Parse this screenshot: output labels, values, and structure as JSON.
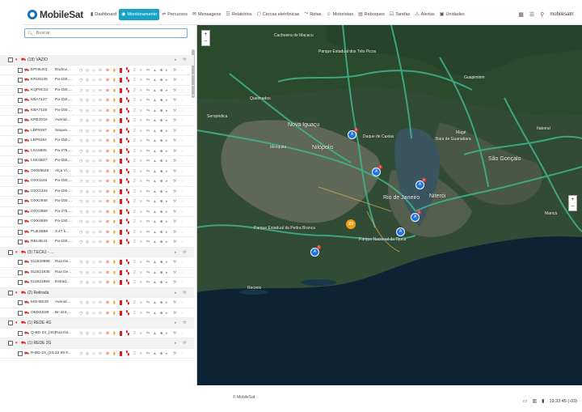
{
  "app": {
    "name": "MobileSat"
  },
  "nav": [
    {
      "label": "Dashboard",
      "icon": "chart-icon",
      "active": false
    },
    {
      "label": "Monitoramento",
      "icon": "monitor-icon",
      "active": true
    },
    {
      "label": "Percursos",
      "icon": "route-icon",
      "active": false
    },
    {
      "label": "Mensagens",
      "icon": "message-icon",
      "active": false
    },
    {
      "label": "Relatórios",
      "icon": "report-icon",
      "active": false
    },
    {
      "label": "Cercas eletrônicas",
      "icon": "fence-icon",
      "active": false
    },
    {
      "label": "Rotas",
      "icon": "road-icon",
      "active": false
    },
    {
      "label": "Motoristas",
      "icon": "driver-icon",
      "active": false
    },
    {
      "label": "Reboques",
      "icon": "trailer-icon",
      "active": false
    },
    {
      "label": "Tarefas",
      "icon": "tasks-icon",
      "active": false
    },
    {
      "label": "Alertas",
      "icon": "alert-icon",
      "active": false
    },
    {
      "label": "Unidades",
      "icon": "unit-icon",
      "active": false
    }
  ],
  "user": {
    "name": "mobilesatrr"
  },
  "search": {
    "placeholder": "Buscar",
    "value": ""
  },
  "rows": [
    {
      "type": "group",
      "name": "(18) VAZIO"
    },
    {
      "type": "vehicle",
      "plate": "EPH6J03",
      "addr": "Rodovi..."
    },
    {
      "type": "vehicle",
      "plate": "KRU8105",
      "addr": "Pa-150,..."
    },
    {
      "type": "vehicle",
      "plate": "KQP8C10",
      "addr": "Pa-150,..."
    },
    {
      "type": "vehicle",
      "plate": "KBA7127",
      "addr": "Pa-150,..."
    },
    {
      "type": "vehicle",
      "plate": "KBA7128",
      "addr": "Pa-150,..."
    },
    {
      "type": "vehicle",
      "plate": "KRE2019",
      "addr": "Avenid..."
    },
    {
      "type": "vehicle",
      "plate": "LBP8187",
      "addr": "Sequei..."
    },
    {
      "type": "vehicle",
      "plate": "LBP8184",
      "addr": "Pa-150,..."
    },
    {
      "type": "vehicle",
      "plate": "LSA5505",
      "addr": "Pa-275,..."
    },
    {
      "type": "vehicle",
      "plate": "LSE4B27",
      "addr": "Pa-150,..."
    },
    {
      "type": "vehicle",
      "plate": "OXW9628",
      "addr": "Alça Vi..."
    },
    {
      "type": "vehicle",
      "plate": "OXX1184",
      "addr": "Pa-150,..."
    },
    {
      "type": "vehicle",
      "plate": "OXX1244",
      "addr": "Pa-150,..."
    },
    {
      "type": "vehicle",
      "plate": "OXX2948",
      "addr": "Pa-150,..."
    },
    {
      "type": "vehicle",
      "plate": "OXX2968",
      "addr": "Pa-275,..."
    },
    {
      "type": "vehicle",
      "plate": "OXX4659",
      "addr": "Pa-150,..."
    },
    {
      "type": "vehicle",
      "plate": "PUE2B98",
      "addr": "3.47 k..."
    },
    {
      "type": "vehicle",
      "plate": "RBL6E43",
      "addr": "Pa-150,..."
    },
    {
      "type": "group",
      "name": "(3) TECRJ - ..."
    },
    {
      "type": "vehicle",
      "plate": "511620998",
      "addr": "Rua De..."
    },
    {
      "type": "vehicle",
      "plate": "511621835",
      "addr": "Rua De..."
    },
    {
      "type": "vehicle",
      "plate": "511621884",
      "addr": "Estrad..."
    },
    {
      "type": "group",
      "name": "(2) Retirada"
    },
    {
      "type": "vehicle",
      "plate": "MSH0E49",
      "addr": "Avenid..."
    },
    {
      "type": "vehicle",
      "plate": "OMX5D39",
      "addr": "Br-324,..."
    },
    {
      "type": "group",
      "name": "(1) REDE 4G"
    },
    {
      "type": "vehicle",
      "plate": "Q-BD-23_(4G)",
      "addr": "Rua Da..."
    },
    {
      "type": "group",
      "name": "(1) REDE 2G"
    },
    {
      "type": "vehicle",
      "plate": "R-BD-23_(2G...",
      "addr": "22 69 K..."
    }
  ],
  "map": {
    "labels": [
      {
        "t": "Cachoeira de Macacu",
        "big": false
      },
      {
        "t": "Parque Estadual dos Três Picos",
        "big": false
      },
      {
        "t": "Queimados",
        "big": false
      },
      {
        "t": "Nova Iguaçu",
        "big": true
      },
      {
        "t": "Mesquita",
        "big": false
      },
      {
        "t": "Nilópolis",
        "big": true
      },
      {
        "t": "Duque de Caxias",
        "big": false
      },
      {
        "t": "Baía de Guanabara",
        "big": false
      },
      {
        "t": "São Gonçalo",
        "big": true
      },
      {
        "t": "Niterói",
        "big": true
      },
      {
        "t": "Rio de Janeiro",
        "big": true
      },
      {
        "t": "Parque Estadual da Pedra Branca",
        "big": false
      },
      {
        "t": "Parque Nacional da Tijuca",
        "big": false
      },
      {
        "t": "Guapimirim",
        "big": false
      },
      {
        "t": "Magé",
        "big": false
      },
      {
        "t": "Itaboraí",
        "big": false
      },
      {
        "t": "Maricá",
        "big": false
      },
      {
        "t": "Seropédica",
        "big": false
      },
      {
        "t": "Recreio",
        "big": false
      }
    ],
    "cluster": "23"
  },
  "footer": {
    "copyright": "© MobileSat",
    "clock": "19:33:45 (-03)"
  },
  "colors": {
    "accent": "#17a2c7",
    "sea": "#0d2233",
    "land": "#2e4a2f",
    "road": "#3fb58f"
  }
}
